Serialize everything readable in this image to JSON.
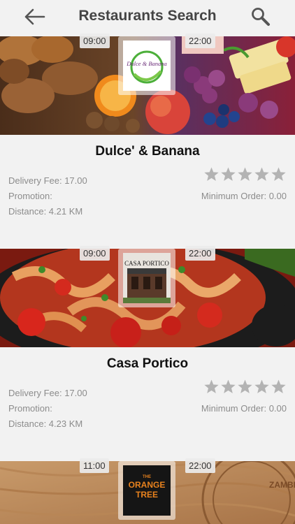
{
  "header": {
    "title": "Restaurants Search",
    "back_icon": "arrow-left-icon",
    "search_icon": "search-icon"
  },
  "colors": {
    "background": "#f2f2f2",
    "star_empty": "#b3b3b3",
    "meta_text": "#8c8c8c"
  },
  "restaurants": [
    {
      "name": "Dulce' & Banana",
      "open_time": "09:00",
      "close_time": "22:00",
      "delivery_fee": "Delivery Fee: 17.00",
      "promotion": "Promotion:",
      "distance": "Distance: 4.21 KM",
      "minimum_order": "Minimum Order: 0.00",
      "rating": 0,
      "logo_text": "Dulce & Banana"
    },
    {
      "name": "Casa Portico",
      "open_time": "09:00",
      "close_time": "22:00",
      "delivery_fee": "Delivery Fee: 17.00",
      "promotion": "Promotion:",
      "distance": "Distance: 4.23 KM",
      "minimum_order": "Minimum Order: 0.00",
      "rating": 0,
      "logo_text": "CASA PORTICO"
    },
    {
      "name": "",
      "open_time": "11:00",
      "close_time": "22:00",
      "logo_text": "THE ORANGE TREE"
    }
  ]
}
